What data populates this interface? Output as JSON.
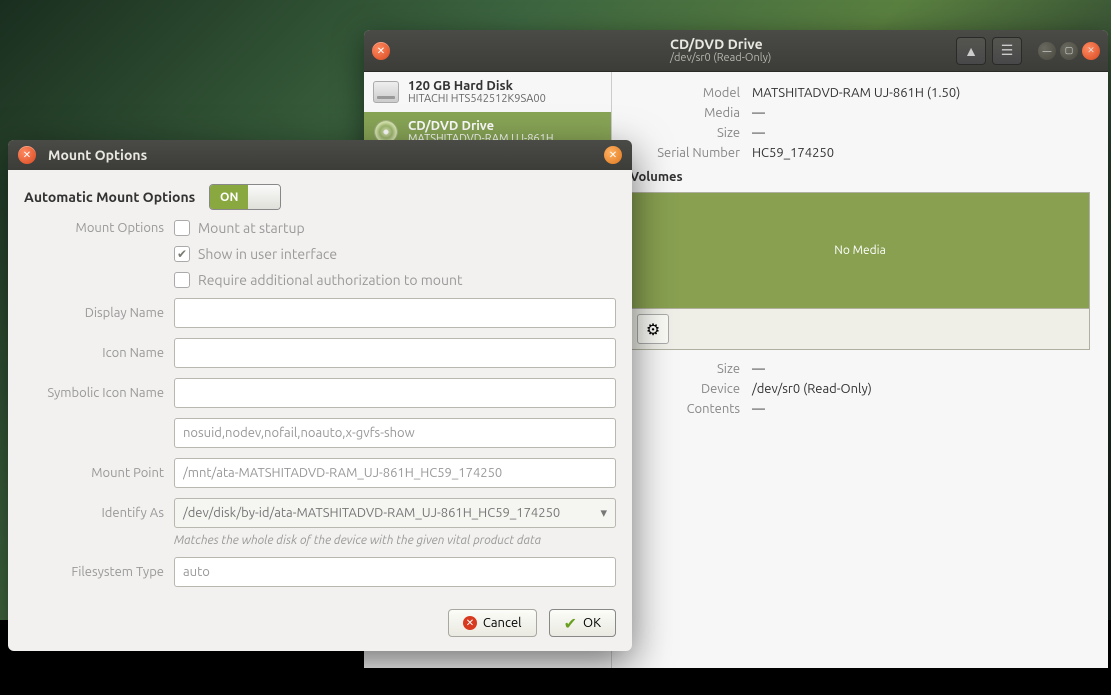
{
  "main_window": {
    "title": "CD/DVD Drive",
    "subtitle": "/dev/sr0 (Read-Only)",
    "eject_hint": "▲",
    "menu_hint": "☰",
    "sidebar": [
      {
        "title": "120 GB Hard Disk",
        "subtitle": "HITACHI HTS542512K9SA00",
        "icon": "hdd"
      },
      {
        "title": "CD/DVD Drive",
        "subtitle": "MATSHITADVD-RAM UJ-861H",
        "icon": "cd",
        "selected": true
      }
    ],
    "details": {
      "model_k": "Model",
      "model_v": "MATSHITADVD-RAM UJ-861H (1.50)",
      "media_k": "Media",
      "media_v": "—",
      "size_k": "Size",
      "size_v": "—",
      "serial_k": "Serial Number",
      "serial_v": "HC59_174250"
    },
    "volumes_hdr": "Volumes",
    "no_media": "No Media",
    "vol_details": {
      "size_k": "Size",
      "size_v": "—",
      "device_k": "Device",
      "device_v": "/dev/sr0 (Read-Only)",
      "contents_k": "Contents",
      "contents_v": "—"
    }
  },
  "dialog": {
    "title": "Mount Options",
    "auto_label": "Automatic Mount Options",
    "switch_on": "ON",
    "labels": {
      "mount_options": "Mount Options",
      "display_name": "Display Name",
      "icon_name": "Icon Name",
      "symbolic_icon_name": "Symbolic Icon Name",
      "mount_point": "Mount Point",
      "identify_as": "Identify As",
      "filesystem_type": "Filesystem Type"
    },
    "checkboxes": {
      "mount_at_startup": "Mount at startup",
      "show_in_ui": "Show in user interface",
      "require_auth": "Require additional authorization to mount"
    },
    "values": {
      "display_name": "",
      "icon_name": "",
      "symbolic_icon_name": "",
      "options_line": "nosuid,nodev,nofail,noauto,x-gvfs-show",
      "mount_point": "/mnt/ata-MATSHITADVD-RAM_UJ-861H_HC59_174250",
      "identify_as": "/dev/disk/by-id/ata-MATSHITADVD-RAM_UJ-861H_HC59_174250",
      "filesystem_type": "auto"
    },
    "help": "Matches the whole disk of the device with the given vital product data",
    "buttons": {
      "cancel": "Cancel",
      "ok": "OK"
    }
  }
}
